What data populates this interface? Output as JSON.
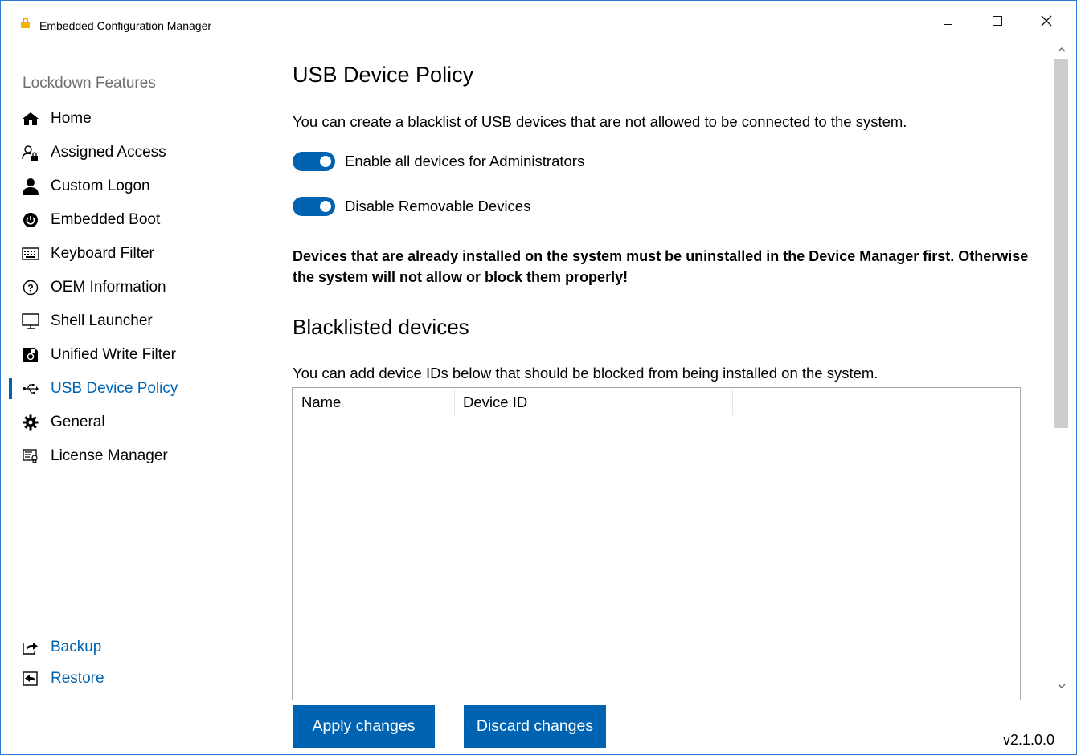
{
  "window": {
    "title": "Embedded Configuration Manager",
    "icon": "padlock-icon",
    "controls": [
      "minimize-icon",
      "maximize-icon",
      "close-icon"
    ]
  },
  "sidebar": {
    "heading": "Lockdown Features",
    "items": [
      {
        "label": "Home",
        "icon": "home-icon"
      },
      {
        "label": "Assigned Access",
        "icon": "user-lock-icon"
      },
      {
        "label": "Custom Logon",
        "icon": "person-icon"
      },
      {
        "label": "Embedded Boot",
        "icon": "power-icon"
      },
      {
        "label": "Keyboard Filter",
        "icon": "keyboard-icon"
      },
      {
        "label": "OEM Information",
        "icon": "help-circle-icon"
      },
      {
        "label": "Shell Launcher",
        "icon": "monitor-icon"
      },
      {
        "label": "Unified Write Filter",
        "icon": "disk-icon"
      },
      {
        "label": "USB Device Policy",
        "icon": "usb-icon",
        "active": true
      },
      {
        "label": "General",
        "icon": "gear-icon"
      },
      {
        "label": "License Manager",
        "icon": "certificate-icon"
      }
    ],
    "footer_links": [
      {
        "label": "Backup",
        "icon": "export-icon"
      },
      {
        "label": "Restore",
        "icon": "import-icon"
      }
    ]
  },
  "main": {
    "title": "USB Device Policy",
    "description": "You can create a blacklist of USB devices that are not allowed to be connected to the system.",
    "toggles": [
      {
        "label": "Enable all devices for Administrators",
        "state": "on"
      },
      {
        "label": "Disable Removable Devices",
        "state": "on"
      }
    ],
    "warning": "Devices that are already installed on the system must be uninstalled in the Device Manager first. Otherwise the system will not allow or block them properly!",
    "section_title": "Blacklisted devices",
    "section_description": "You can add device IDs below that should be blocked from being installed on the system.",
    "table": {
      "columns": [
        "Name",
        "Device ID"
      ],
      "rows": []
    }
  },
  "actions": {
    "apply_label": "Apply changes",
    "discard_label": "Discard changes"
  },
  "version": "v2.1.0.0",
  "colors": {
    "accent": "#0063b1",
    "window_border": "#2b79d4",
    "toggle_on": "#0063b1",
    "sidebar_heading": "#6e6e6e"
  }
}
